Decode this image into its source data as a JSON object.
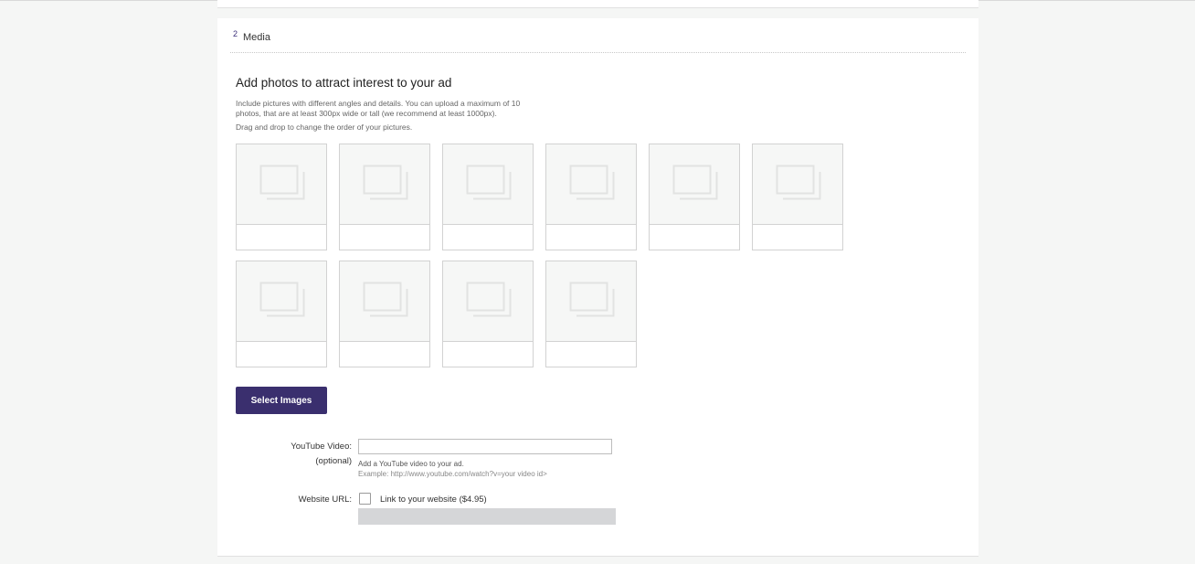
{
  "section": {
    "number": "2",
    "title": "Media"
  },
  "photos": {
    "heading": "Add photos to attract interest to your ad",
    "description": "Include pictures with different angles and details. You can upload a maximum of 10 photos, that are at least 300px wide or tall (we recommend at least 1000px).",
    "reorder_hint": "Drag and drop to change the order of your pictures.",
    "slot_count": 10,
    "slot_icon": "photo-placeholder-icon",
    "select_button": "Select Images"
  },
  "youtube": {
    "label": "YouTube Video:",
    "optional": "(optional)",
    "value": "",
    "help": "Add a YouTube video to your ad.",
    "example": "Example: http://www.youtube.com/watch?v=your video id>"
  },
  "website": {
    "label": "Website URL:",
    "checkbox_label": "Link to your website ($4.95)",
    "checked": false,
    "value": ""
  },
  "colors": {
    "accent": "#3a2f6e",
    "background": "#f5f6f5"
  }
}
